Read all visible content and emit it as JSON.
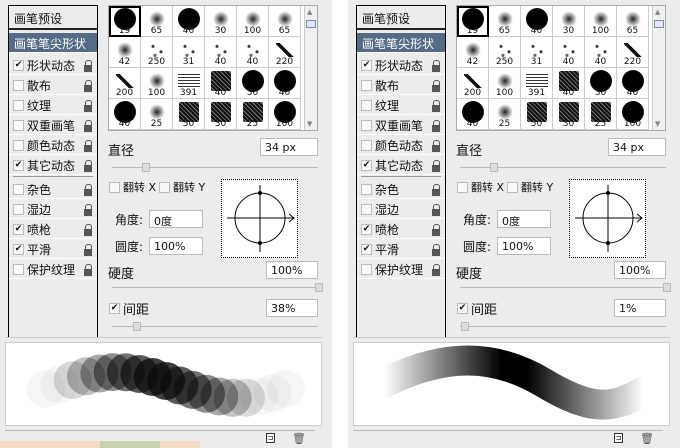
{
  "panels": [
    {
      "preset_header": "画笔预设",
      "items": [
        {
          "label": "画笔笔尖形状",
          "selected": true
        },
        {
          "label": "形状动态",
          "checked": true
        },
        {
          "label": "散布",
          "checked": false
        },
        {
          "label": "纹理",
          "checked": false
        },
        {
          "label": "双重画笔",
          "checked": false
        },
        {
          "label": "颜色动态",
          "checked": false
        },
        {
          "label": "其它动态",
          "checked": true
        },
        {
          "label": "杂色",
          "checked": false
        },
        {
          "label": "湿边",
          "checked": false
        },
        {
          "label": "喷枪",
          "checked": true
        },
        {
          "label": "平滑",
          "checked": true
        },
        {
          "label": "保护纹理",
          "checked": false
        }
      ],
      "brushes": [
        "19",
        "65",
        "40",
        "30",
        "100",
        "65",
        "42",
        "250",
        "31",
        "40",
        "40",
        "220",
        "200",
        "100",
        "391",
        "40",
        "30",
        "40",
        "40",
        "25",
        "50",
        "30",
        "25",
        "100"
      ],
      "diameter_label": "直径",
      "diameter_value": "34 px",
      "flip_x": "翻转 X",
      "flip_y": "翻转 Y",
      "angle_label": "角度:",
      "angle_value": "0度",
      "roundness_label": "圆度:",
      "roundness_value": "100%",
      "hardness_label": "硬度",
      "hardness_value": "100%",
      "spacing_label": "间距",
      "spacing_value": "38%",
      "spacing_checked": true,
      "stroke": "dabs"
    },
    {
      "preset_header": "画笔预设",
      "items": [
        {
          "label": "画笔笔尖形状",
          "selected": true
        },
        {
          "label": "形状动态",
          "checked": true
        },
        {
          "label": "散布",
          "checked": false
        },
        {
          "label": "纹理",
          "checked": false
        },
        {
          "label": "双重画笔",
          "checked": false
        },
        {
          "label": "颜色动态",
          "checked": false
        },
        {
          "label": "其它动态",
          "checked": true
        },
        {
          "label": "杂色",
          "checked": false
        },
        {
          "label": "湿边",
          "checked": false
        },
        {
          "label": "喷枪",
          "checked": true
        },
        {
          "label": "平滑",
          "checked": true
        },
        {
          "label": "保护纹理",
          "checked": false
        }
      ],
      "brushes": [
        "19",
        "65",
        "40",
        "30",
        "100",
        "65",
        "42",
        "250",
        "31",
        "40",
        "40",
        "220",
        "200",
        "100",
        "391",
        "40",
        "30",
        "40",
        "40",
        "25",
        "50",
        "30",
        "25",
        "100"
      ],
      "diameter_label": "直径",
      "diameter_value": "34 px",
      "flip_x": "翻转 X",
      "flip_y": "翻转 Y",
      "angle_label": "角度:",
      "angle_value": "0度",
      "roundness_label": "圆度:",
      "roundness_value": "100%",
      "hardness_label": "硬度",
      "hardness_value": "100%",
      "spacing_label": "间距",
      "spacing_value": "1%",
      "spacing_checked": true,
      "stroke": "smooth"
    }
  ]
}
